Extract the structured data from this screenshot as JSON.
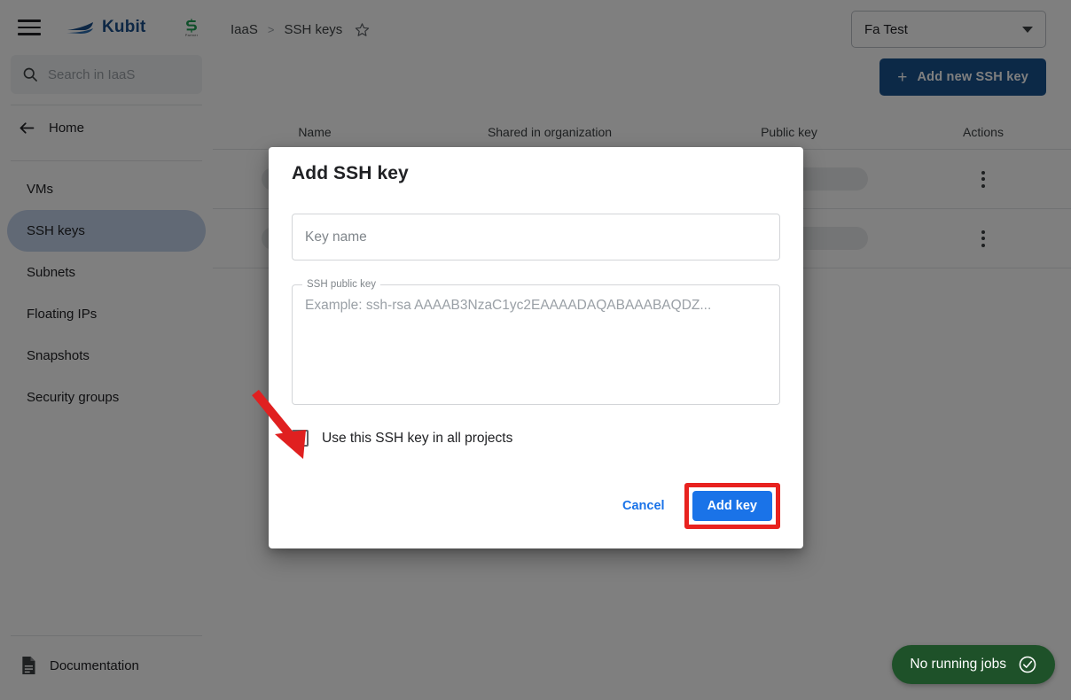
{
  "sidebar": {
    "menu_icon": "hamburger-icon",
    "brand_name": "Kubit",
    "brand_logo_icon": "kubit-boat-logo",
    "partner_logo_icon": "partner-s-logo",
    "partner_logo_caption": "Partner",
    "search": {
      "icon": "search-icon",
      "placeholder": "Search in IaaS",
      "value": ""
    },
    "home": {
      "icon": "arrow-left-icon",
      "label": "Home"
    },
    "items": [
      {
        "label": "VMs",
        "active": false
      },
      {
        "label": "SSH keys",
        "active": true
      },
      {
        "label": "Subnets",
        "active": false
      },
      {
        "label": "Floating IPs",
        "active": false
      },
      {
        "label": "Snapshots",
        "active": false
      },
      {
        "label": "Security groups",
        "active": false
      }
    ],
    "documentation": {
      "icon": "document-icon",
      "label": "Documentation"
    },
    "active_bg": "#c2d3ea"
  },
  "topbar": {
    "breadcrumb": {
      "root": "IaaS",
      "separator": ">",
      "current": "SSH keys",
      "favorite_icon": "star-outline-icon"
    },
    "project_select": {
      "value": "Fa Test",
      "caret_icon": "chevron-down-icon"
    }
  },
  "actions": {
    "add_new_ssh_key": {
      "icon": "plus-icon",
      "label": "Add new SSH key",
      "color": "#19538f"
    }
  },
  "table": {
    "columns": [
      "Name",
      "Shared in organization",
      "Public key",
      "Actions"
    ],
    "rows": [
      {
        "name": "",
        "shared": "",
        "public_key": "",
        "actions_icon": "more-vertical-icon"
      },
      {
        "name": "",
        "shared": "",
        "public_key": "",
        "actions_icon": "more-vertical-icon"
      }
    ]
  },
  "dialog": {
    "title": "Add SSH key",
    "key_name_field": {
      "placeholder": "Key name",
      "value": ""
    },
    "public_key_field": {
      "legend": "SSH public key",
      "placeholder": "Example: ssh-rsa AAAAB3NzaC1yc2EAAAADAQABAAABAQDZ...",
      "value": ""
    },
    "checkbox": {
      "label": "Use this SSH key in all projects",
      "checked": false
    },
    "cancel_label": "Cancel",
    "submit_label": "Add key",
    "submit_color": "#1a73e8",
    "highlight_color": "#e8221f"
  },
  "annotation": {
    "arrow_color": "#e02020",
    "points_to": "use-this-ssh-key-checkbox"
  },
  "status": {
    "jobs_label": "No running jobs",
    "jobs_icon": "check-circle-icon",
    "jobs_bg": "#1e5129"
  }
}
